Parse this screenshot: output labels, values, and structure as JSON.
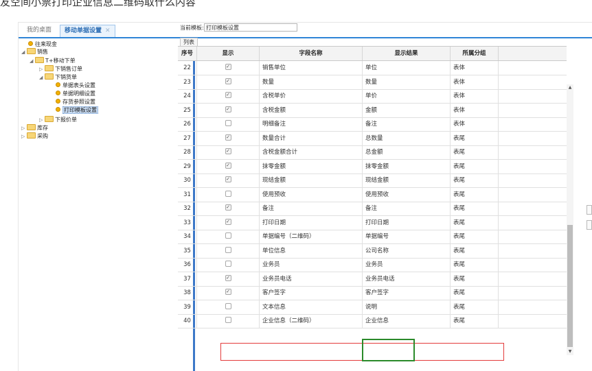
{
  "page_header": {
    "title": "友空间小票打印企业信息二维码取什么内容"
  },
  "tabs": [
    {
      "label": "我的桌面",
      "active": false
    },
    {
      "label": "移动单据设置",
      "active": true
    }
  ],
  "tab_close_glyph": "✕",
  "tree": {
    "items": [
      {
        "label": "往来现金",
        "type": "leaf"
      },
      {
        "label": "销售",
        "type": "folder",
        "expanded": true
      },
      {
        "label": "T+移动下单",
        "type": "folder",
        "expanded": true
      },
      {
        "label": "下销售订单",
        "type": "folder",
        "expanded": false
      },
      {
        "label": "下销货单",
        "type": "folder",
        "expanded": true
      },
      {
        "label": "单据表头设置",
        "type": "leaf"
      },
      {
        "label": "单据明细设置",
        "type": "leaf"
      },
      {
        "label": "存货参照设置",
        "type": "leaf"
      },
      {
        "label": "打印模板设置",
        "type": "leaf",
        "selected": true
      },
      {
        "label": "下报价单",
        "type": "folder",
        "expanded": false
      },
      {
        "label": "库存",
        "type": "folder",
        "expanded": false
      },
      {
        "label": "采购",
        "type": "folder",
        "expanded": false
      }
    ]
  },
  "template": {
    "label": "当前模板:",
    "value": "打印模板设置",
    "list_tab": "列表"
  },
  "grid": {
    "columns": [
      "序号",
      "显示",
      "字段名称",
      "显示结果",
      "所属分组"
    ],
    "rows": [
      {
        "num": "22",
        "checked": true,
        "name": "销售单位",
        "result": "单位",
        "group": "表体"
      },
      {
        "num": "23",
        "checked": true,
        "name": "数量",
        "result": "数量",
        "group": "表体"
      },
      {
        "num": "24",
        "checked": true,
        "name": "含税单价",
        "result": "单价",
        "group": "表体"
      },
      {
        "num": "25",
        "checked": true,
        "name": "含税金额",
        "result": "金额",
        "group": "表体"
      },
      {
        "num": "26",
        "checked": false,
        "name": "明细备注",
        "result": "备注",
        "group": "表体"
      },
      {
        "num": "27",
        "checked": true,
        "name": "数量合计",
        "result": "总数量",
        "group": "表尾"
      },
      {
        "num": "28",
        "checked": true,
        "name": "含税金额合计",
        "result": "总金额",
        "group": "表尾"
      },
      {
        "num": "29",
        "checked": true,
        "name": "抹零金额",
        "result": "抹零金额",
        "group": "表尾"
      },
      {
        "num": "30",
        "checked": true,
        "name": "现结金额",
        "result": "现结金额",
        "group": "表尾"
      },
      {
        "num": "31",
        "checked": false,
        "name": "使用预收",
        "result": "使用预收",
        "group": "表尾"
      },
      {
        "num": "32",
        "checked": true,
        "name": "备注",
        "result": "备注",
        "group": "表尾"
      },
      {
        "num": "33",
        "checked": true,
        "name": "打印日期",
        "result": "打印日期",
        "group": "表尾"
      },
      {
        "num": "34",
        "checked": false,
        "name": "单据编号（二维码）",
        "result": "单据编号",
        "group": "表尾"
      },
      {
        "num": "35",
        "checked": false,
        "name": "单位信息",
        "result": "公司名称",
        "group": "表尾"
      },
      {
        "num": "36",
        "checked": false,
        "name": "业务员",
        "result": "业务员",
        "group": "表尾"
      },
      {
        "num": "37",
        "checked": true,
        "name": "业务员电话",
        "result": "业务员电话",
        "group": "表尾"
      },
      {
        "num": "38",
        "checked": true,
        "name": "客户签字",
        "result": "客户签字",
        "group": "表尾"
      },
      {
        "num": "39",
        "checked": false,
        "name": "文本信息",
        "result": "说明",
        "group": "表尾"
      },
      {
        "num": "40",
        "checked": false,
        "name": "企业信息（二维码）",
        "result": "企业信息",
        "group": "表尾"
      }
    ]
  },
  "icons": {
    "check": "✓",
    "expanded": "◢",
    "collapsed": "▷",
    "scroll_up": "▲",
    "scroll_down": "▼"
  },
  "colors": {
    "accent": "#2e84d6",
    "highlight_red": "#e33a3a",
    "highlight_green": "#2a8a2a"
  }
}
